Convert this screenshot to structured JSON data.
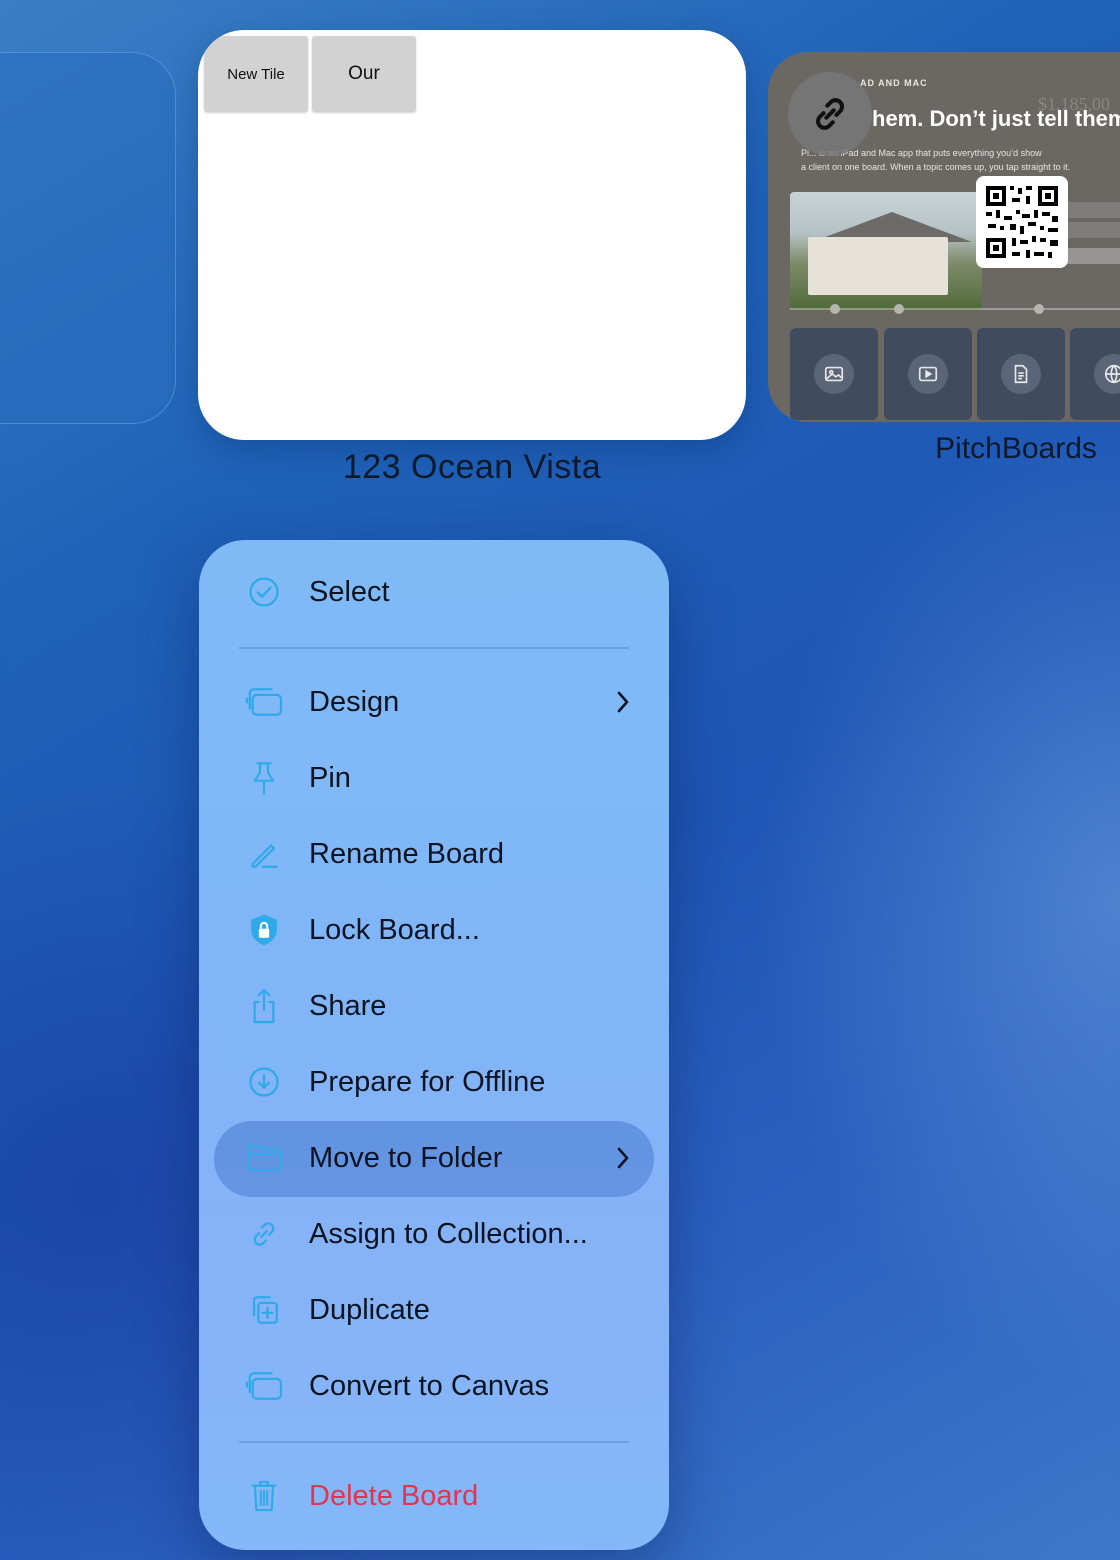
{
  "board": {
    "title": "123 Ocean Vista",
    "tiles": [
      "New Tile",
      "Our"
    ]
  },
  "pitchboards": {
    "label": "PitchBoards",
    "preview": {
      "eyebrow": "AD AND MAC",
      "heading": "hem. Don’t just tell them",
      "body_line1": "Pi... is an iPad and Mac app that puts everything you’d show",
      "body_line2": "a client on one board. When a topic comes up, you tap straight to it.",
      "price": "$1,185,00"
    }
  },
  "menu": {
    "items": [
      {
        "label": "Select",
        "icon": "checkmark-circle-icon"
      },
      {
        "label": "Design",
        "icon": "canvas-stack-icon",
        "submenu": true
      },
      {
        "label": "Pin",
        "icon": "pin-icon"
      },
      {
        "label": "Rename Board",
        "icon": "pencil-icon"
      },
      {
        "label": "Lock Board...",
        "icon": "lock-shield-icon"
      },
      {
        "label": "Share",
        "icon": "share-icon"
      },
      {
        "label": "Prepare for Offline",
        "icon": "download-circle-icon"
      },
      {
        "label": "Move to Folder",
        "icon": "folder-icon",
        "submenu": true,
        "highlighted": true
      },
      {
        "label": "Assign to Collection...",
        "icon": "link-icon"
      },
      {
        "label": "Duplicate",
        "icon": "duplicate-icon"
      },
      {
        "label": "Convert to Canvas",
        "icon": "canvas-stack-icon"
      },
      {
        "label": "Delete Board",
        "icon": "trash-icon",
        "destructive": true
      }
    ]
  },
  "colors": {
    "accent": "#2fa9e8",
    "destructive": "#e0354c",
    "menu_bg": "#80b6f8"
  }
}
